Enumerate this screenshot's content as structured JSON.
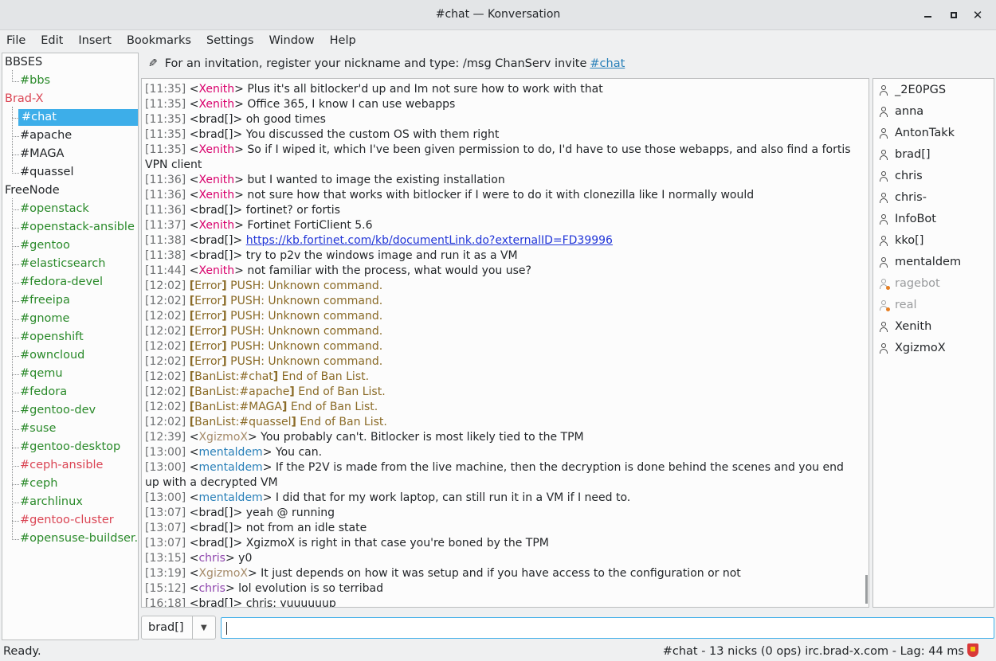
{
  "window": {
    "title": "#chat — Konversation"
  },
  "menu": [
    "File",
    "Edit",
    "Insert",
    "Bookmarks",
    "Settings",
    "Window",
    "Help"
  ],
  "tree": [
    {
      "type": "server",
      "label": "BBSES",
      "color": "#232629"
    },
    {
      "type": "channel",
      "label": "#bbs",
      "color": "#2a8a2a"
    },
    {
      "type": "server",
      "label": "Brad-X",
      "color": "#da4453"
    },
    {
      "type": "channel",
      "label": "#chat",
      "color": "#ffffff",
      "selected": true
    },
    {
      "type": "channel",
      "label": "#apache",
      "color": "#232629"
    },
    {
      "type": "channel",
      "label": "#MAGA",
      "color": "#232629"
    },
    {
      "type": "channel",
      "label": "#quassel",
      "color": "#232629"
    },
    {
      "type": "server",
      "label": "FreeNode",
      "color": "#232629"
    },
    {
      "type": "channel",
      "label": "#openstack",
      "color": "#2a8a2a"
    },
    {
      "type": "channel",
      "label": "#openstack-ansible",
      "color": "#2a8a2a"
    },
    {
      "type": "channel",
      "label": "#gentoo",
      "color": "#2a8a2a"
    },
    {
      "type": "channel",
      "label": "#elasticsearch",
      "color": "#2a8a2a"
    },
    {
      "type": "channel",
      "label": "#fedora-devel",
      "color": "#2a8a2a"
    },
    {
      "type": "channel",
      "label": "#freeipa",
      "color": "#2a8a2a"
    },
    {
      "type": "channel",
      "label": "#gnome",
      "color": "#2a8a2a"
    },
    {
      "type": "channel",
      "label": "#openshift",
      "color": "#2a8a2a"
    },
    {
      "type": "channel",
      "label": "#owncloud",
      "color": "#2a8a2a"
    },
    {
      "type": "channel",
      "label": "#qemu",
      "color": "#2a8a2a"
    },
    {
      "type": "channel",
      "label": "#fedora",
      "color": "#2a8a2a"
    },
    {
      "type": "channel",
      "label": "#gentoo-dev",
      "color": "#2a8a2a"
    },
    {
      "type": "channel",
      "label": "#suse",
      "color": "#2a8a2a"
    },
    {
      "type": "channel",
      "label": "#gentoo-desktop",
      "color": "#2a8a2a"
    },
    {
      "type": "channel",
      "label": "#ceph-ansible",
      "color": "#da4453"
    },
    {
      "type": "channel",
      "label": "#ceph",
      "color": "#2a8a2a"
    },
    {
      "type": "channel",
      "label": "#archlinux",
      "color": "#2a8a2a"
    },
    {
      "type": "channel",
      "label": "#gentoo-cluster",
      "color": "#da4453"
    },
    {
      "type": "channel",
      "label": "#opensuse-buildser...",
      "color": "#2a8a2a"
    }
  ],
  "topic": {
    "text": "For an invitation, register your nickname and type: /msg ChanServ invite",
    "link": "#chat"
  },
  "messages": [
    {
      "ts": "[11:35]",
      "nick": "Xenith",
      "nc": "nick-red",
      "text": "Plus it's all bitlocker'd up and Im not sure how to work with that"
    },
    {
      "ts": "[11:35]",
      "nick": "Xenith",
      "nc": "nick-red",
      "text": "Office 365, I know I can use webapps"
    },
    {
      "ts": "[11:35]",
      "nick": "brad[]",
      "nc": "",
      "text": "oh good times"
    },
    {
      "ts": "[11:35]",
      "nick": "brad[]",
      "nc": "",
      "text": "You discussed the custom OS with them right"
    },
    {
      "ts": "[11:35]",
      "nick": "Xenith",
      "nc": "nick-red",
      "text": "So if I wiped it, which I've been given permission to do, I'd have to use those webapps, and also find a fortis VPN client"
    },
    {
      "ts": "[11:36]",
      "nick": "Xenith",
      "nc": "nick-red",
      "text": "but I wanted to image the existing installation"
    },
    {
      "ts": "[11:36]",
      "nick": "Xenith",
      "nc": "nick-red",
      "text": "not sure how that works with bitlocker if I were to do it with clonezilla like I normally would"
    },
    {
      "ts": "[11:36]",
      "nick": "brad[]",
      "nc": "",
      "text": "fortinet? or fortis"
    },
    {
      "ts": "[11:37]",
      "nick": "Xenith",
      "nc": "nick-red",
      "text": "Fortinet FortiClient 5.6"
    },
    {
      "ts": "[11:38]",
      "nick": "brad[]",
      "nc": "",
      "text": "",
      "link": "https://kb.fortinet.com/kb/documentLink.do?externalID=FD39996"
    },
    {
      "ts": "[11:38]",
      "nick": "brad[]",
      "nc": "",
      "text": "try to p2v the windows image and run it as a VM"
    },
    {
      "ts": "[11:44]",
      "nick": "Xenith",
      "nc": "nick-red",
      "text": "not familiar with the process, what would you use?"
    },
    {
      "ts": "[12:02]",
      "sys": "Error",
      "text": "PUSH: Unknown command."
    },
    {
      "ts": "[12:02]",
      "sys": "Error",
      "text": "PUSH: Unknown command."
    },
    {
      "ts": "[12:02]",
      "sys": "Error",
      "text": "PUSH: Unknown command."
    },
    {
      "ts": "[12:02]",
      "sys": "Error",
      "text": "PUSH: Unknown command."
    },
    {
      "ts": "[12:02]",
      "sys": "Error",
      "text": "PUSH: Unknown command."
    },
    {
      "ts": "[12:02]",
      "sys": "Error",
      "text": "PUSH: Unknown command."
    },
    {
      "ts": "[12:02]",
      "sys": "BanList:#chat",
      "text": "End of Ban List."
    },
    {
      "ts": "[12:02]",
      "sys": "BanList:#apache",
      "text": "End of Ban List."
    },
    {
      "ts": "[12:02]",
      "sys": "BanList:#MAGA",
      "text": "End of Ban List."
    },
    {
      "ts": "[12:02]",
      "sys": "BanList:#quassel",
      "text": "End of Ban List."
    },
    {
      "ts": "[12:39]",
      "nick": "XgizmoX",
      "nc": "nick-tan",
      "text": "You probably can't.  Bitlocker is most likely tied to the TPM"
    },
    {
      "ts": "[13:00]",
      "nick": "mentaldem",
      "nc": "nick-blue",
      "text": "You can."
    },
    {
      "ts": "[13:00]",
      "nick": "mentaldem",
      "nc": "nick-blue",
      "text": "If the P2V is made from the live machine, then the decryption is done behind the scenes and you end up with a decrypted VM"
    },
    {
      "ts": "[13:00]",
      "nick": "mentaldem",
      "nc": "nick-blue",
      "text": "I did that for my work laptop, can still run it in a VM if I need to."
    },
    {
      "ts": "[13:07]",
      "nick": "brad[]",
      "nc": "",
      "text": "yeah @ running"
    },
    {
      "ts": "[13:07]",
      "nick": "brad[]",
      "nc": "",
      "text": "not from an idle state"
    },
    {
      "ts": "[13:07]",
      "nick": "brad[]",
      "nc": "",
      "text": "XgizmoX is right in that case you're boned by the TPM"
    },
    {
      "ts": "[13:15]",
      "nick": "chris",
      "nc": "nick-purple",
      "text": "y0"
    },
    {
      "ts": "[13:19]",
      "nick": "XgizmoX",
      "nc": "nick-tan",
      "text": "It just depends on how it was setup and if you have access to the configuration or not"
    },
    {
      "ts": "[15:12]",
      "nick": "chris",
      "nc": "nick-purple",
      "text": "lol evolution is so terribad"
    },
    {
      "ts": "[16:18]",
      "nick": "brad[]",
      "nc": "",
      "text": "chris: yuuuuuup"
    }
  ],
  "nicks": [
    {
      "name": "_2E0PGS",
      "away": false
    },
    {
      "name": "anna",
      "away": false
    },
    {
      "name": "AntonTakk",
      "away": false
    },
    {
      "name": "brad[]",
      "away": false
    },
    {
      "name": "chris",
      "away": false
    },
    {
      "name": "chris-",
      "away": false
    },
    {
      "name": "InfoBot",
      "away": false
    },
    {
      "name": "kko[]",
      "away": false
    },
    {
      "name": "mentaldem",
      "away": false
    },
    {
      "name": "ragebot",
      "away": true
    },
    {
      "name": "real",
      "away": true,
      "mark": true
    },
    {
      "name": "Xenith",
      "away": false
    },
    {
      "name": "XgizmoX",
      "away": false
    }
  ],
  "input": {
    "nick": "brad[]",
    "value": ""
  },
  "status": {
    "left": "Ready.",
    "right": "#chat - 13 nicks (0 ops)  irc.brad-x.com - Lag: 44 ms"
  },
  "icons": {
    "edit_topic": "pencil-icon",
    "user": "user-icon",
    "ssl": "ssl-shield-icon",
    "combo_arrow": "chevron-down-icon"
  }
}
